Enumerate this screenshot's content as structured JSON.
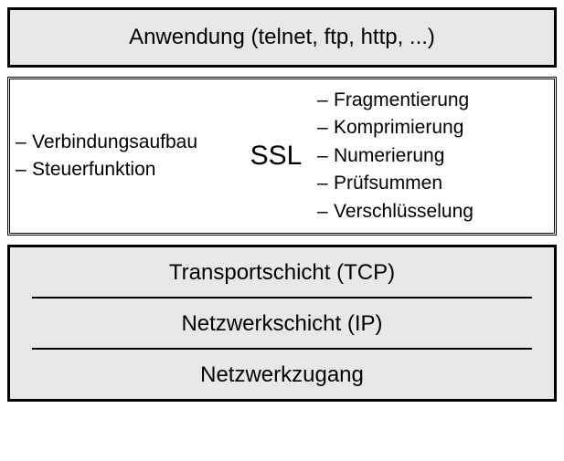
{
  "app_layer": {
    "title": "Anwendung  (telnet, ftp, http, ...)"
  },
  "ssl_layer": {
    "center_label": "SSL",
    "left_items": [
      "Verbindungsaufbau",
      "Steuerfunktion"
    ],
    "right_items": [
      "Fragmentierung",
      "Komprimierung",
      "Numerierung",
      "Prüfsummen",
      "Verschlüsselung"
    ]
  },
  "lower_layer": {
    "rows": [
      "Transportschicht (TCP)",
      "Netzwerkschicht (IP)",
      "Netzwerkzugang"
    ]
  }
}
